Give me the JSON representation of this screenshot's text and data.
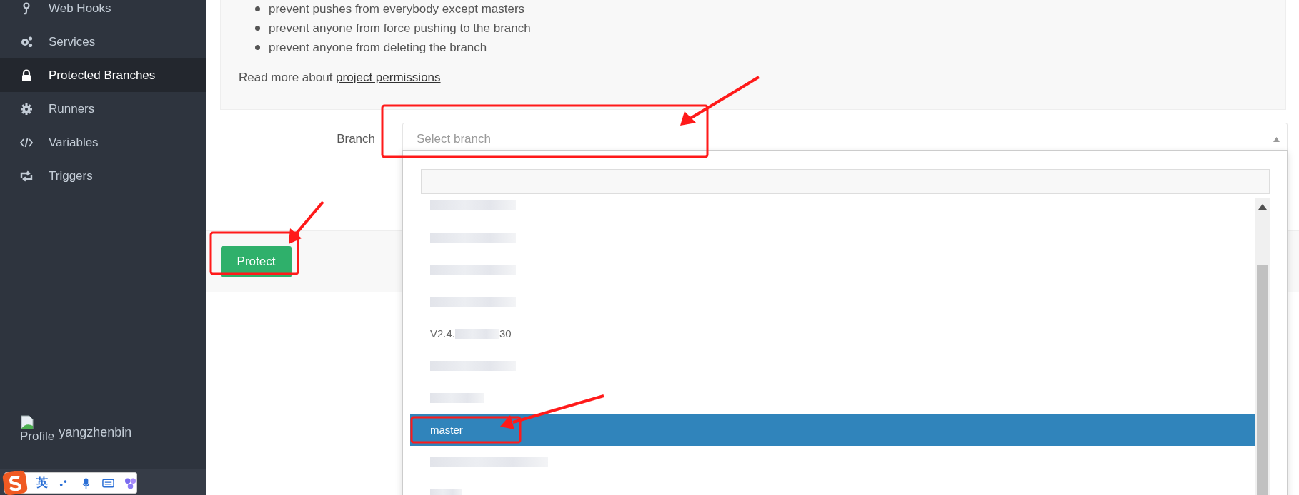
{
  "sidebar": {
    "items": [
      {
        "label": "Web Hooks",
        "selected": false
      },
      {
        "label": "Services",
        "selected": false
      },
      {
        "label": "Protected Branches",
        "selected": true
      },
      {
        "label": "Runners",
        "selected": false
      },
      {
        "label": "Variables",
        "selected": false
      },
      {
        "label": "Triggers",
        "selected": false
      }
    ],
    "profile": {
      "image_alt": "Profile",
      "username": "yangzhenbin"
    }
  },
  "info_panel": {
    "bullets": [
      "prevent pushes from everybody except masters",
      "prevent anyone from force pushing to the branch",
      "prevent anyone from deleting the branch"
    ],
    "read_more": "Read more about ",
    "link": "project permissions"
  },
  "form": {
    "label": "Branch",
    "select": {
      "placeholder": "Select branch",
      "expanded": true
    }
  },
  "dropdown": {
    "options": [
      {
        "kind": "blurred",
        "selected": false
      },
      {
        "kind": "blurred",
        "selected": false
      },
      {
        "kind": "blurred",
        "selected": false
      },
      {
        "kind": "blurred",
        "selected": false
      },
      {
        "kind": "partial",
        "start": "V2.4.",
        "end": "30",
        "selected": false
      },
      {
        "kind": "blurred",
        "selected": false
      },
      {
        "kind": "blurred",
        "selected": false
      },
      {
        "kind": "text",
        "label": "master",
        "selected": true
      },
      {
        "kind": "blurred",
        "selected": false
      },
      {
        "kind": "blurred",
        "selected": false
      }
    ]
  },
  "actions": {
    "button": "Protect"
  },
  "ime_toolbar": {
    "label": "英"
  }
}
